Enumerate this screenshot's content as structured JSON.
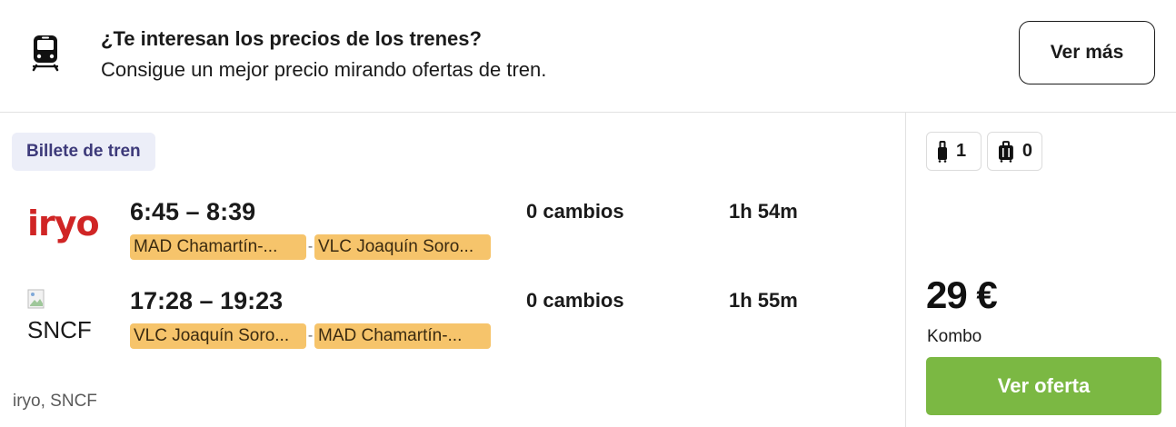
{
  "banner": {
    "title": "¿Te interesan los precios de los trenes?",
    "subtitle": "Consigue un mejor precio mirando ofertas de tren.",
    "button_label": "Ver más",
    "icon": "train-icon"
  },
  "result": {
    "badge": "Billete de tren",
    "legs": [
      {
        "logo_text": "iryo",
        "logo_color": "#d02525",
        "time": "6:45 – 8:39",
        "from": "MAD Chamartín-...",
        "to": "VLC Joaquín Soro...",
        "dash": "-",
        "changes": "0 cambios",
        "duration": "1h 54m"
      },
      {
        "logo_text": "SNCF",
        "time": "17:28 – 19:23",
        "from": "VLC Joaquín Soro...",
        "to": "MAD Chamartín-...",
        "dash": "-",
        "changes": "0 cambios",
        "duration": "1h 55m"
      }
    ],
    "carriers": "iryo, SNCF"
  },
  "sidebar": {
    "carry_on_count": "1",
    "checked_bag_count": "0",
    "price": "29 €",
    "provider": "Kombo",
    "cta_label": "Ver oferta",
    "cta_color": "#7bb843",
    "stop_color": "#f6c46b"
  }
}
